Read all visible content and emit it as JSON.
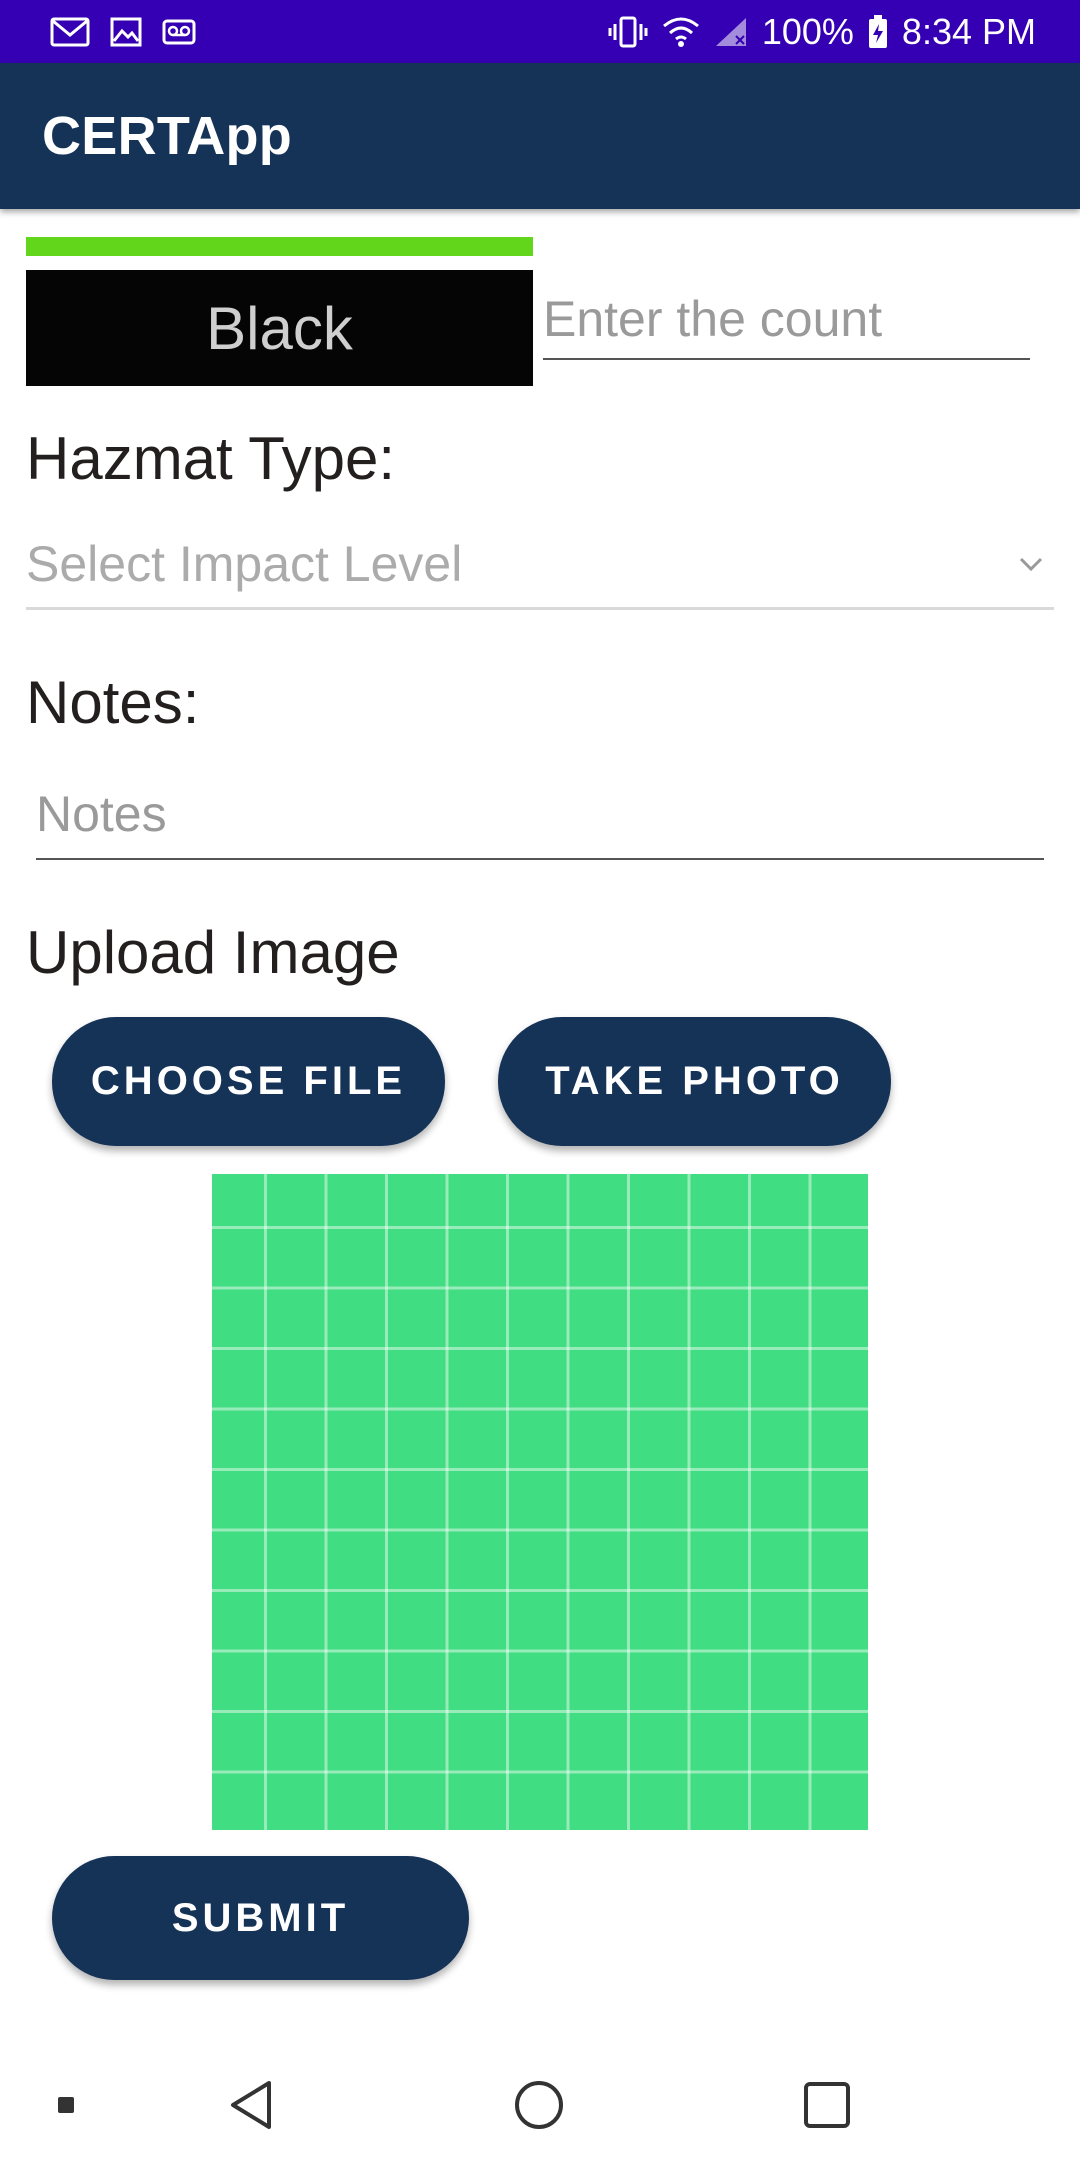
{
  "status_bar": {
    "left_icons": [
      "gmail-icon",
      "image-icon",
      "voicemail-icon"
    ],
    "right_icons": [
      "vibrate-icon",
      "wifi-icon",
      "cellular-signal-icon",
      "battery-charging-icon"
    ],
    "battery": "100%",
    "time": "8:34 PM",
    "color": "#3500b3"
  },
  "app_bar": {
    "title": "CERTApp",
    "color": "#153257"
  },
  "triage": {
    "progress_fraction": 1.0,
    "progress_color": "#62d61a",
    "color_label": "Black",
    "color_value": "#050505",
    "count_placeholder": "Enter the count"
  },
  "hazmat": {
    "label": "Hazmat Type:",
    "selected": "Select Impact Level"
  },
  "notes": {
    "label": "Notes:",
    "placeholder": "Notes"
  },
  "upload": {
    "label": "Upload Image",
    "choose_file": "CHOOSE FILE",
    "take_photo": "TAKE PHOTO",
    "preview_color": "#41dd82"
  },
  "actions": {
    "submit": "SUBMIT"
  },
  "nav_bar": {
    "items": [
      "recents-dot-icon",
      "back-icon",
      "home-icon",
      "overview-icon"
    ]
  }
}
